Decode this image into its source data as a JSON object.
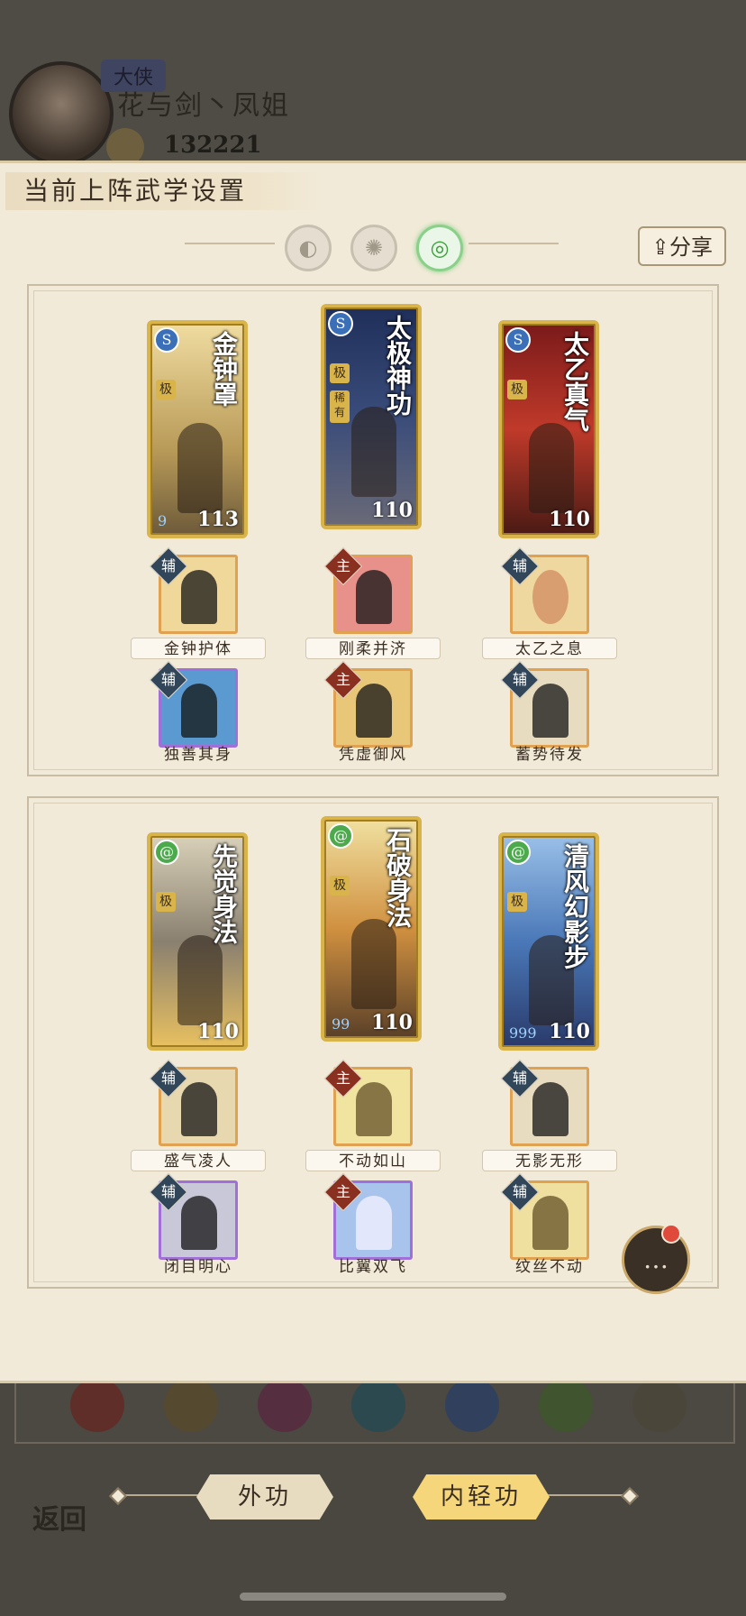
{
  "player": {
    "rank_title": "大侠",
    "name": "花与剑丶凤姐",
    "power": "132221"
  },
  "panel": {
    "title": "当前上阵武学设置",
    "share_label": "分享"
  },
  "presets": [
    {
      "icon": "moon-icon",
      "active": false
    },
    {
      "icon": "sun-icon",
      "active": false
    },
    {
      "icon": "jade-ring-icon",
      "active": true
    }
  ],
  "groups": [
    {
      "cards": [
        {
          "name": "金钟罩",
          "level": "113",
          "grade": "极",
          "type_icon": "yin-yang-icon",
          "dots": "9",
          "rare": ""
        },
        {
          "name": "太极神功",
          "level": "110",
          "grade": "极",
          "type_icon": "yin-yang-icon",
          "dots": "",
          "rare": "稀有"
        },
        {
          "name": "太乙真气",
          "level": "110",
          "grade": "极",
          "type_icon": "yin-yang-icon",
          "dots": "",
          "rare": ""
        }
      ],
      "skills_row1": [
        {
          "tag": "辅",
          "label": "金钟护体"
        },
        {
          "tag": "主",
          "label": "刚柔并济"
        },
        {
          "tag": "辅",
          "label": "太乙之息"
        }
      ],
      "skills_row2": [
        {
          "tag": "辅",
          "label": "独善其身"
        },
        {
          "tag": "主",
          "label": "凭虚御风"
        },
        {
          "tag": "辅",
          "label": "蓄势待发"
        }
      ]
    },
    {
      "cards": [
        {
          "name": "先觉身法",
          "level": "110",
          "grade": "极",
          "type_icon": "swirl-icon",
          "dots": "",
          "rare": ""
        },
        {
          "name": "石破身法",
          "level": "110",
          "grade": "极",
          "type_icon": "swirl-icon",
          "dots": "99",
          "rare": ""
        },
        {
          "name": "清风幻影步",
          "level": "110",
          "grade": "极",
          "type_icon": "swirl-icon",
          "dots": "999",
          "rare": ""
        }
      ],
      "skills_row1": [
        {
          "tag": "辅",
          "label": "盛气凌人"
        },
        {
          "tag": "主",
          "label": "不动如山"
        },
        {
          "tag": "辅",
          "label": "无影无形"
        }
      ],
      "skills_row2": [
        {
          "tag": "辅",
          "label": "闭目明心"
        },
        {
          "tag": "主",
          "label": "比翼双飞"
        },
        {
          "tag": "辅",
          "label": "纹丝不动"
        }
      ]
    }
  ],
  "tabs": [
    {
      "label": "外功",
      "active": false
    },
    {
      "label": "内轻功",
      "active": true
    }
  ],
  "back_label": "返回",
  "colors": {
    "panel_bg": "#f1ead8",
    "gold_border": "#d9b44a",
    "active_tab": "#f5d67a",
    "assist_tag": "#32465a",
    "main_tag": "#8a3020"
  }
}
